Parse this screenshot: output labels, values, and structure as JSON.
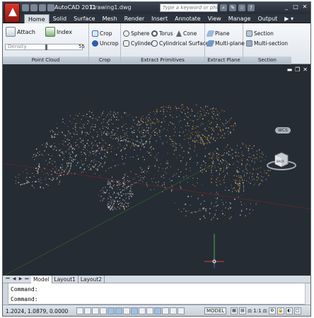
{
  "title_bar": {
    "app_name": "AutoCAD 2011",
    "document": "Drawing1.dwg",
    "search_placeholder": "Type a keyword or phrase",
    "help": "?"
  },
  "ribbon_tabs": [
    "Home",
    "Solid",
    "Surface",
    "Mesh",
    "Render",
    "Insert",
    "Annotate",
    "View",
    "Manage",
    "Output"
  ],
  "active_tab": "Home",
  "panels": {
    "point_cloud": {
      "title": "Point Cloud",
      "attach": "Attach",
      "index": "Index",
      "density_label": "Density",
      "density_value": "55"
    },
    "crop": {
      "title": "Crop",
      "crop": "Crop",
      "uncrop": "Uncrop"
    },
    "extract_primitives": {
      "title": "Extract Primitives",
      "sphere": "Sphere",
      "torus": "Torus",
      "cone": "Cone",
      "cylinder": "Cylinder",
      "cylindrical_surface": "Cylindrical Surface"
    },
    "extract_plane": {
      "title": "Extract Plane",
      "plane": "Plane",
      "multi_plane": "Multi-plane"
    },
    "section": {
      "title": "Section",
      "section": "Section",
      "multi_section": "Multi-section"
    }
  },
  "viewcube": {
    "wcs": "WCS",
    "face": "BACK"
  },
  "layout_tabs": [
    "Model",
    "Layout1",
    "Layout2"
  ],
  "active_layout": "Model",
  "command_lines": [
    "Command:",
    "Command:"
  ],
  "status": {
    "coordinates": "1.2024, 1.0879, 0.0000",
    "model": "MODEL",
    "scale": "1:1"
  },
  "colors": {
    "accent_red": "#c92a1e",
    "viewport_bg": "#262c33",
    "ribbon_bg": "#e8edf2"
  }
}
